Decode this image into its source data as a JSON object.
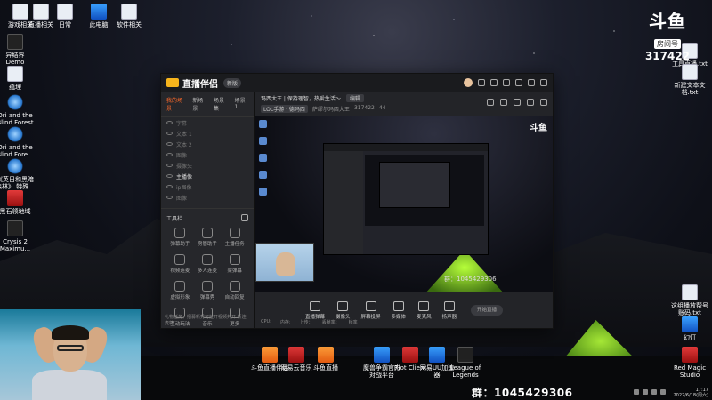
{
  "desktop": {
    "top_icons": [
      "游戏相关",
      "直播相关",
      "日常",
      "此电脑",
      "软件相关"
    ],
    "left_icons": [
      "异结界\nDemo",
      "蕴理",
      "Ori and the\nBlind Forest",
      "Ori and the\nBlind Fore...",
      "《英日和黑暗\n森林》 特殊...",
      "黑石领地域",
      "Crysis 2\nMaximu..."
    ],
    "right_icons": [
      "工具直播.txt",
      "新建文本文\n档.txt",
      "这组播放帮号\n账码.txt",
      "幻灯",
      "Red Magic\nStudio"
    ],
    "taskbar_apps": [
      "斗鱼直播伴侣",
      "网易云音乐",
      "斗鱼直播",
      "魔兽争霸官方\n对战平台",
      "Riot Client",
      "网易UU加速\n器",
      "League of\nLegends"
    ]
  },
  "brand": {
    "logo": "斗鱼",
    "room_label": "房间号",
    "room_number": "317422"
  },
  "window": {
    "app_name": "直播伴侣",
    "version_badge": "新版",
    "left_tabs": [
      "我的场景",
      "新场景",
      "场景集",
      "场景1"
    ],
    "scenes": [
      "字幕",
      "文本 1",
      "文本 2",
      "图像",
      "摄像头",
      "主播像",
      "ip图像",
      "图像"
    ],
    "tools_title": "工具栏",
    "tools": [
      "弹幕助手",
      "房管助手",
      "主播任务",
      "视频连麦",
      "多人连麦",
      "梁弹幕",
      "虚拟形象",
      "弹幕秀",
      "自动回复",
      "互动玩法",
      "音乐",
      "更多"
    ],
    "footer": "礼物任务，招募新秀可拉开视频并开 新连麦特",
    "stream_title": "玛西大王 | 保持理智，热爱生活～",
    "edit_label": "编辑",
    "category": "LOL手游 · 德玛西",
    "anchor": "萨缪尔玛西大王",
    "room": "317422",
    "hot": "44",
    "preview_group": "群：1045429306",
    "controls": [
      "直播弹幕",
      "摄像头",
      "屏幕投屏",
      "多媒体",
      "麦克风",
      "扬声器"
    ],
    "start_label": "开始直播",
    "status": [
      "CPU:",
      "内存:",
      "上传：",
      "丢帧率：",
      "帧率"
    ]
  },
  "overlay": {
    "group_text": "群：1045429306"
  },
  "tray": {
    "time": "17:17",
    "date": "2022/6/18(周六)"
  }
}
